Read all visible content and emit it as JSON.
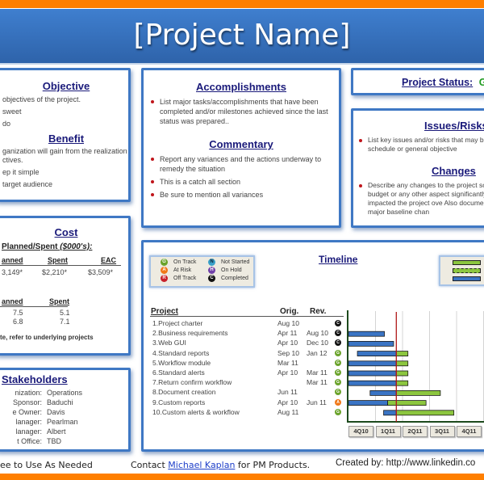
{
  "header": {
    "title": "[Project Name]"
  },
  "objective": {
    "title": "Objective",
    "lines": [
      "objectives of the project.",
      "sweet",
      "do"
    ]
  },
  "benefit": {
    "title": "Benefit",
    "lines": [
      "ganization will gain from the realization",
      "ctives.",
      "ep it simple",
      "target audience"
    ]
  },
  "accomplishments": {
    "title": "Accomplishments",
    "bullets": [
      "List major tasks/accomplishments that have been completed and/or milestones achieved since the last status was prepared.."
    ]
  },
  "commentary": {
    "title": "Commentary",
    "bullets": [
      "Report any variances and the actions underway to remedy the situation",
      "This is a catch all section",
      "Be  sure to mention all variances"
    ]
  },
  "status": {
    "label": "Project Status:",
    "value": "Gr",
    "value_color": "#1f9a1f"
  },
  "issues": {
    "title": "Issues/Risks",
    "bullets": [
      "List key issues and/or risks that may budget, schedule or general objective"
    ]
  },
  "changes": {
    "title": "Changes",
    "bullets": [
      "Describe any changes to the project schedule, budget or any other aspect significantly impacted the project ove Also documents major baseline chan"
    ]
  },
  "cost": {
    "title": "Cost",
    "subtitle": "Planned/Spent",
    "subtitle_units": "($000's):",
    "table1": {
      "headers": [
        "anned",
        "Spent",
        "EAC"
      ],
      "row": [
        "3,149*",
        "$2,210*",
        "$3,509*"
      ]
    },
    "table2": {
      "headers": [
        "anned",
        "Spent"
      ],
      "rows": [
        [
          "7.5",
          "5.1"
        ],
        [
          "6.8",
          "7.1"
        ]
      ]
    },
    "note": "te, refer to underlying projects"
  },
  "stakeholders": {
    "title": "Stakeholders",
    "rows": [
      {
        "k": "nization:",
        "v": "Operations"
      },
      {
        "k": "Sponsor:",
        "v": "Baduchi"
      },
      {
        "k": "e Owner:",
        "v": "Davis"
      },
      {
        "k": "lanager:",
        "v": "Pearlman"
      },
      {
        "k": "lanager:",
        "v": "Albert"
      },
      {
        "k": "t Office:",
        "v": "TBD"
      }
    ]
  },
  "timeline": {
    "title": "Timeline",
    "legend": [
      {
        "code": "G",
        "label": "On Track",
        "color": "#6aa32a"
      },
      {
        "code": "A",
        "label": "At Risk",
        "color": "#f07818"
      },
      {
        "code": "R",
        "label": "Off Track",
        "color": "#c8202a"
      },
      {
        "code": "N",
        "label": "Not Started",
        "color": "#3aa0c8"
      },
      {
        "code": "H",
        "label": "On Hold",
        "color": "#7040a8"
      },
      {
        "code": "C",
        "label": "Completed",
        "color": "#111111"
      }
    ],
    "headers": {
      "project": "Project",
      "orig": "Orig.",
      "rev": "Rev."
    },
    "quarters": [
      "4Q10",
      "1Q11",
      "2Q11",
      "3Q11",
      "4Q11"
    ],
    "rows": [
      {
        "name": "1.Project charter",
        "orig": "Aug 10",
        "rev": "",
        "status": "C",
        "plan": null,
        "actual": null
      },
      {
        "name": "2.Business requirements",
        "orig": "Apr 11",
        "rev": "Aug 10",
        "status": "C",
        "blue": [
          0.0,
          1.33
        ],
        "green": null
      },
      {
        "name": "3.Web GUI",
        "orig": "Apr 10",
        "rev": "Dec 10",
        "status": "C",
        "blue": [
          0.0,
          1.67
        ],
        "green": null
      },
      {
        "name": "4.Standard reports",
        "orig": "Sep 10",
        "rev": "Jan 12",
        "status": "G",
        "blue": [
          0.33,
          1.77
        ],
        "green": [
          1.77,
          2.2
        ]
      },
      {
        "name": "5.Workflow module",
        "orig": "Mar 11",
        "rev": "",
        "status": "G",
        "blue": [
          0.0,
          1.77
        ],
        "green": [
          1.77,
          2.2
        ]
      },
      {
        "name": "6.Standard alerts",
        "orig": "Apr 10",
        "rev": "Mar 11",
        "status": "G",
        "blue": [
          0.0,
          1.77
        ],
        "green": [
          1.77,
          2.2
        ]
      },
      {
        "name": "7.Return confirm workflow",
        "orig": "",
        "rev": "Mar 11",
        "status": "G",
        "blue": [
          0.0,
          1.77
        ],
        "green": [
          1.77,
          2.2
        ]
      },
      {
        "name": "8.Document creation",
        "orig": "Jun 11",
        "rev": "",
        "status": "G",
        "blue": [
          0.8,
          1.77
        ],
        "green": [
          1.77,
          3.4
        ]
      },
      {
        "name": "9.Custom reports",
        "orig": "Apr 10",
        "rev": "Jun 11",
        "status": "A",
        "blue": [
          0.0,
          1.45
        ],
        "green": [
          1.45,
          2.87
        ]
      },
      {
        "name": "10.Custom alerts & workflow",
        "orig": "Aug 11",
        "rev": "",
        "status": "G",
        "blue": [
          1.3,
          1.77
        ],
        "green": [
          1.77,
          3.9
        ]
      }
    ],
    "today_marker": 1.77
  },
  "footer": {
    "left": "ee to  Use As Needed",
    "contact_prefix": "Contact ",
    "contact_link": "Michael Kaplan",
    "contact_suffix": " for PM Products.",
    "created_by": "Created by: http://www.linkedin.co"
  }
}
